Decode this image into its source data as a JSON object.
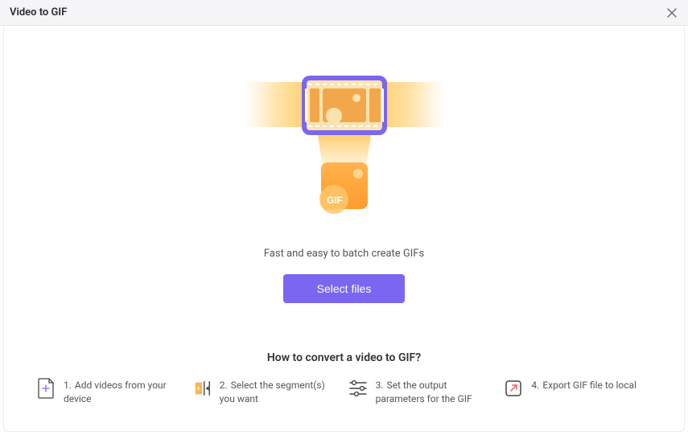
{
  "titlebar": {
    "title": "Video to GIF"
  },
  "hero": {
    "tagline": "Fast and easy to batch create GIFs",
    "select_btn": "Select files",
    "gif_label": "GIF"
  },
  "howto": {
    "title": "How to convert a video to GIF?",
    "steps": [
      {
        "num": "1.",
        "text": "Add videos from your device"
      },
      {
        "num": "2.",
        "text": "Select the segment(s) you want"
      },
      {
        "num": "3.",
        "text": "Set the output parameters for the GIF"
      },
      {
        "num": "4.",
        "text": "Export GIF file to local"
      }
    ]
  }
}
